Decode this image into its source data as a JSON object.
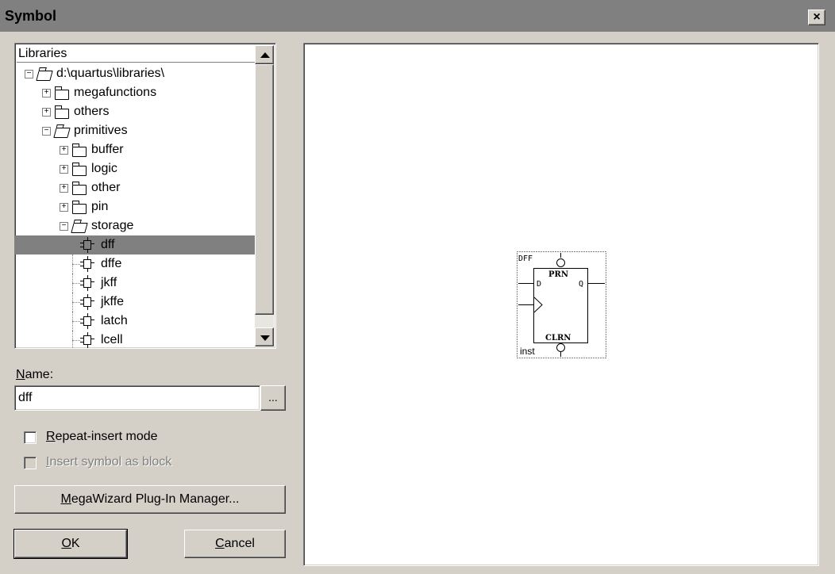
{
  "window": {
    "title": "Symbol",
    "close_glyph": "×"
  },
  "tree": {
    "header": "Libraries",
    "nodes": [
      {
        "label": "d:\\quartus\\libraries\\",
        "expander": "−",
        "icon": "open-folder-icon"
      },
      {
        "label": "megafunctions",
        "expander": "+",
        "icon": "folder-icon"
      },
      {
        "label": "others",
        "expander": "+",
        "icon": "folder-icon"
      },
      {
        "label": "primitives",
        "expander": "−",
        "icon": "open-folder-icon"
      },
      {
        "label": "buffer",
        "expander": "+",
        "icon": "folder-icon"
      },
      {
        "label": "logic",
        "expander": "+",
        "icon": "folder-icon"
      },
      {
        "label": "other",
        "expander": "+",
        "icon": "folder-icon"
      },
      {
        "label": "pin",
        "expander": "+",
        "icon": "folder-icon"
      },
      {
        "label": "storage",
        "expander": "−",
        "icon": "open-folder-icon"
      },
      {
        "label": "dff",
        "icon": "symbol-icon",
        "selected": true
      },
      {
        "label": "dffe",
        "icon": "symbol-icon"
      },
      {
        "label": "jkff",
        "icon": "symbol-icon"
      },
      {
        "label": "jkffe",
        "icon": "symbol-icon"
      },
      {
        "label": "latch",
        "icon": "symbol-icon"
      },
      {
        "label": "lcell",
        "icon": "symbol-icon"
      }
    ]
  },
  "name_field": {
    "label_mnemonic": "N",
    "label_rest": "ame:",
    "value": "dff",
    "browse_label": "..."
  },
  "options": {
    "repeat_insert": {
      "mnemonic": "R",
      "rest": "epeat-insert mode",
      "checked": false,
      "enabled": true
    },
    "insert_block": {
      "mnemonic": "I",
      "rest": "nsert symbol as block",
      "checked": false,
      "enabled": false
    }
  },
  "buttons": {
    "megawizard": {
      "mnemonic": "M",
      "rest": "egaWizard Plug-In Manager..."
    },
    "ok": {
      "mnemonic": "O",
      "rest": "K"
    },
    "cancel": {
      "mnemonic": "C",
      "rest": "ancel"
    }
  },
  "preview": {
    "symbol_name": "DFF",
    "instance": "inst",
    "pins": {
      "preset": "PRN",
      "clear": "CLRN",
      "data": "D",
      "output": "Q"
    }
  }
}
